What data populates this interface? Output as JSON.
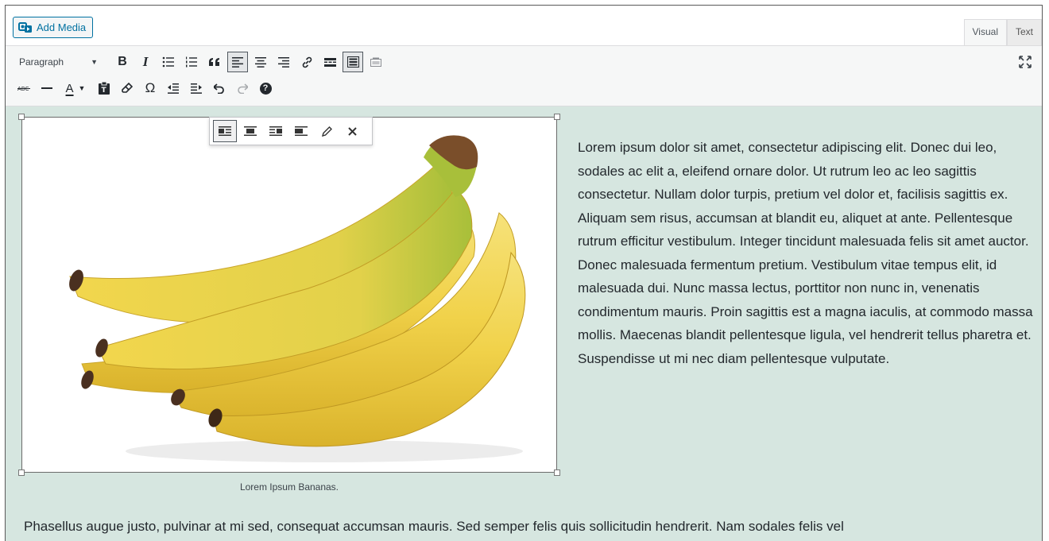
{
  "toolbar_top": {
    "add_media_label": "Add Media",
    "tabs": [
      {
        "label": "Visual",
        "active": true
      },
      {
        "label": "Text",
        "active": false
      }
    ]
  },
  "toolbar": {
    "format_select": "Paragraph",
    "row1_icons": [
      "bold-icon",
      "italic-icon",
      "bulleted-list-icon",
      "numbered-list-icon",
      "blockquote-icon",
      "align-left-icon",
      "align-center-icon",
      "align-right-icon",
      "link-icon",
      "read-more-icon",
      "toolbar-toggle-icon",
      "insert-media-icon"
    ],
    "row2_icons": [
      "strikethrough-icon",
      "horizontal-line-icon",
      "text-color-icon",
      "paste-as-text-icon",
      "clear-formatting-icon",
      "special-character-icon",
      "outdent-icon",
      "indent-icon",
      "undo-icon",
      "redo-icon",
      "help-icon"
    ],
    "bold_glyph": "B",
    "italic_glyph": "I",
    "omega_glyph": "Ω",
    "text_color_glyph": "A",
    "help_glyph": "?"
  },
  "image": {
    "caption": "Lorem Ipsum Bananas.",
    "toolbar_icons": [
      "align-left-icon",
      "align-center-icon",
      "align-right-icon",
      "no-alignment-icon",
      "edit-pencil-icon",
      "remove-icon"
    ]
  },
  "content": {
    "paragraph1": "Lorem ipsum dolor sit amet, consectetur adipiscing elit. Donec dui leo, sodales ac elit a, eleifend ornare dolor. Ut rutrum leo ac leo sagittis consectetur. Nullam dolor turpis, pretium vel dolor et, facilisis sagittis ex. Aliquam sem risus, accumsan at blandit eu, aliquet at ante. Pellentesque rutrum efficitur vestibulum. Integer tincidunt malesuada felis sit amet auctor. Donec malesuada fermentum pretium. Vestibulum vitae tempus elit, id malesuada dui. Nunc massa lectus, porttitor non nunc in, venenatis condimentum mauris. Proin sagittis est a magna iaculis, at commodo massa mollis. Maecenas blandit pellentesque ligula, vel hendrerit tellus pharetra et. Suspendisse ut mi nec diam pellentesque vulputate.",
    "paragraph2": "Phasellus augue justo, pulvinar at mi sed, consequat accumsan mauris. Sed semper felis quis sollicitudin hendrerit. Nam sodales felis vel"
  },
  "colors": {
    "accent": "#0071a1",
    "content_bg": "#d6e6e0",
    "toolbar_bg": "#f6f7f7"
  }
}
